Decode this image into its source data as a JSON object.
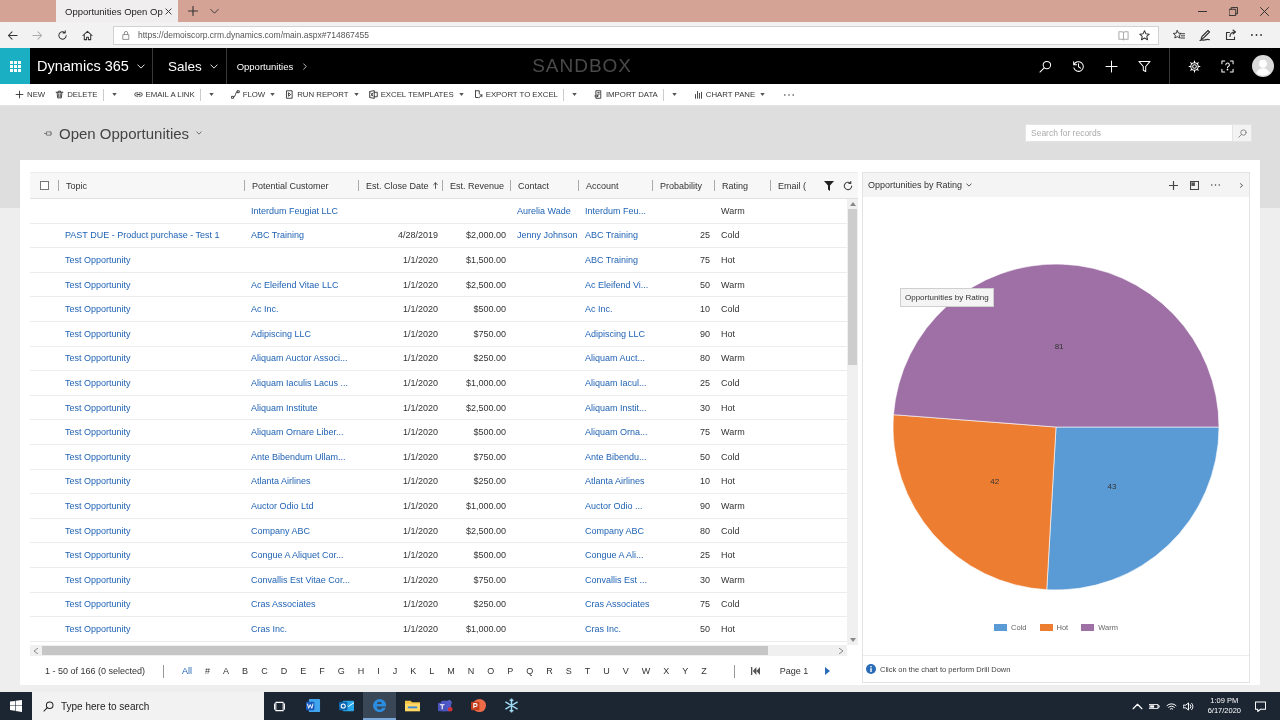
{
  "browser": {
    "tab_title": "Opportunities Open Op",
    "url": "https://demoiscorp.crm.dynamics.com/main.aspx#714867455"
  },
  "app_bar": {
    "app_name": "Dynamics 365",
    "area": "Sales",
    "entity": "Opportunities",
    "environment": "SANDBOX"
  },
  "commands": [
    {
      "label": "NEW",
      "kind": "plain"
    },
    {
      "label": "DELETE",
      "kind": "split"
    },
    {
      "label": "EMAIL A LINK",
      "kind": "split"
    },
    {
      "label": "FLOW",
      "kind": "menu"
    },
    {
      "label": "RUN REPORT",
      "kind": "menu"
    },
    {
      "label": "EXCEL TEMPLATES",
      "kind": "menu"
    },
    {
      "label": "EXPORT TO EXCEL",
      "kind": "split"
    },
    {
      "label": "IMPORT DATA",
      "kind": "split"
    },
    {
      "label": "CHART PANE",
      "kind": "menu"
    }
  ],
  "view": {
    "title": "Open Opportunities",
    "search": {
      "placeholder": "Search for records"
    }
  },
  "grid": {
    "select_all": {
      "checked": false
    },
    "columns": [
      {
        "label": "Topic",
        "sorted": false
      },
      {
        "label": "Potential Customer",
        "sorted": false
      },
      {
        "label": "Est. Close Date",
        "sorted": true
      },
      {
        "label": "Est. Revenue",
        "sorted": false
      },
      {
        "label": "Contact",
        "sorted": false
      },
      {
        "label": "Account",
        "sorted": false
      },
      {
        "label": "Probability",
        "sorted": false
      },
      {
        "label": "Rating",
        "sorted": false
      },
      {
        "label": "Email (",
        "sorted": false
      }
    ],
    "rows": [
      {
        "customer": "Interdum Feugiat LLC",
        "contact": "Aurelia Wade",
        "account": "Interdum Feu...",
        "rating": "Warm"
      },
      {
        "topic": "PAST DUE - Product purchase - Test 1",
        "customer": "ABC Training",
        "close_date": "4/28/2019",
        "revenue": "$2,000.00",
        "contact": "Jenny Johnson",
        "account": "ABC Training",
        "probability": "25",
        "rating": "Cold"
      },
      {
        "topic": "Test Opportunity",
        "close_date": "1/1/2020",
        "revenue": "$1,500.00",
        "account": "ABC Training",
        "probability": "75",
        "rating": "Hot"
      },
      {
        "topic": "Test Opportunity",
        "customer": "Ac Eleifend Vitae LLC",
        "close_date": "1/1/2020",
        "revenue": "$2,500.00",
        "account": "Ac Eleifend Vi...",
        "probability": "50",
        "rating": "Warm"
      },
      {
        "topic": "Test Opportunity",
        "customer": "Ac Inc.",
        "close_date": "1/1/2020",
        "revenue": "$500.00",
        "account": "Ac Inc.",
        "probability": "10",
        "rating": "Cold"
      },
      {
        "topic": "Test Opportunity",
        "customer": "Adipiscing LLC",
        "close_date": "1/1/2020",
        "revenue": "$750.00",
        "account": "Adipiscing LLC",
        "probability": "90",
        "rating": "Hot"
      },
      {
        "topic": "Test Opportunity",
        "customer": "Aliquam Auctor Associ...",
        "close_date": "1/1/2020",
        "revenue": "$250.00",
        "account": "Aliquam Auct...",
        "probability": "80",
        "rating": "Warm"
      },
      {
        "topic": "Test Opportunity",
        "customer": "Aliquam Iaculis Lacus ...",
        "close_date": "1/1/2020",
        "revenue": "$1,000.00",
        "account": "Aliquam Iacul...",
        "probability": "25",
        "rating": "Cold"
      },
      {
        "topic": "Test Opportunity",
        "customer": "Aliquam Institute",
        "close_date": "1/1/2020",
        "revenue": "$2,500.00",
        "account": "Aliquam Instit...",
        "probability": "30",
        "rating": "Hot"
      },
      {
        "topic": "Test Opportunity",
        "customer": "Aliquam Ornare Liber...",
        "close_date": "1/1/2020",
        "revenue": "$500.00",
        "account": "Aliquam Orna...",
        "probability": "75",
        "rating": "Warm"
      },
      {
        "topic": "Test Opportunity",
        "customer": "Ante Bibendum Ullam...",
        "close_date": "1/1/2020",
        "revenue": "$750.00",
        "account": "Ante Bibendu...",
        "probability": "50",
        "rating": "Cold"
      },
      {
        "topic": "Test Opportunity",
        "customer": "Atlanta Airlines",
        "close_date": "1/1/2020",
        "revenue": "$250.00",
        "account": "Atlanta Airlines",
        "probability": "10",
        "rating": "Hot"
      },
      {
        "topic": "Test Opportunity",
        "customer": "Auctor Odio Ltd",
        "close_date": "1/1/2020",
        "revenue": "$1,000.00",
        "account": "Auctor Odio ...",
        "probability": "90",
        "rating": "Warm"
      },
      {
        "topic": "Test Opportunity",
        "customer": "Company ABC",
        "close_date": "1/1/2020",
        "revenue": "$2,500.00",
        "account": "Company ABC",
        "probability": "80",
        "rating": "Cold"
      },
      {
        "topic": "Test Opportunity",
        "customer": "Congue A Aliquet Cor...",
        "close_date": "1/1/2020",
        "revenue": "$500.00",
        "account": "Congue A Ali...",
        "probability": "25",
        "rating": "Hot"
      },
      {
        "topic": "Test Opportunity",
        "customer": "Convallis Est Vitae Cor...",
        "close_date": "1/1/2020",
        "revenue": "$750.00",
        "account": "Convallis Est ...",
        "probability": "30",
        "rating": "Warm"
      },
      {
        "topic": "Test Opportunity",
        "customer": "Cras Associates",
        "close_date": "1/1/2020",
        "revenue": "$250.00",
        "account": "Cras Associates",
        "probability": "75",
        "rating": "Cold"
      },
      {
        "topic": "Test Opportunity",
        "customer": "Cras Inc.",
        "close_date": "1/1/2020",
        "revenue": "$1,000.00",
        "account": "Cras Inc.",
        "probability": "50",
        "rating": "Hot"
      }
    ],
    "record_count": "1 - 50 of 166 (0 selected)",
    "letters": [
      {
        "label": "All",
        "selected": true
      },
      {
        "label": "#",
        "selected": false
      },
      {
        "label": "A",
        "selected": false
      },
      {
        "label": "B",
        "selected": false
      },
      {
        "label": "C",
        "selected": false
      },
      {
        "label": "D",
        "selected": false
      },
      {
        "label": "E",
        "selected": false
      },
      {
        "label": "F",
        "selected": false
      },
      {
        "label": "G",
        "selected": false
      },
      {
        "label": "H",
        "selected": false
      },
      {
        "label": "I",
        "selected": false
      },
      {
        "label": "J",
        "selected": false
      },
      {
        "label": "K",
        "selected": false
      },
      {
        "label": "L",
        "selected": false
      },
      {
        "label": "M",
        "selected": false
      },
      {
        "label": "N",
        "selected": false
      },
      {
        "label": "O",
        "selected": false
      },
      {
        "label": "P",
        "selected": false
      },
      {
        "label": "Q",
        "selected": false
      },
      {
        "label": "R",
        "selected": false
      },
      {
        "label": "S",
        "selected": false
      },
      {
        "label": "T",
        "selected": false
      },
      {
        "label": "U",
        "selected": false
      },
      {
        "label": "V",
        "selected": false
      },
      {
        "label": "W",
        "selected": false
      },
      {
        "label": "X",
        "selected": false
      },
      {
        "label": "Y",
        "selected": false
      },
      {
        "label": "Z",
        "selected": false
      }
    ],
    "pager": {
      "label": "Page 1",
      "previous_disabled": true,
      "next_disabled": false
    }
  },
  "chart_pane": {
    "title": "Opportunities by Rating",
    "chart_data": {
      "type": "pie",
      "title": "Opportunities by Rating",
      "categories": [
        "Cold",
        "Hot",
        "Warm"
      ],
      "values": [
        43,
        42,
        81
      ],
      "colors": [
        "#5b9bd5",
        "#ed7d31",
        "#9e70a5"
      ],
      "data_labels": true
    },
    "hint": "Click on the chart to perform Drill Down"
  },
  "taskbar": {
    "search": {
      "placeholder": "Type here to search"
    },
    "apps": [
      {
        "selected": false
      },
      {
        "selected": false
      },
      {
        "selected": true
      },
      {
        "selected": false
      },
      {
        "selected": false
      },
      {
        "selected": false
      },
      {
        "selected": false
      }
    ],
    "time": "1:09 PM",
    "date": "6/17/2020"
  }
}
